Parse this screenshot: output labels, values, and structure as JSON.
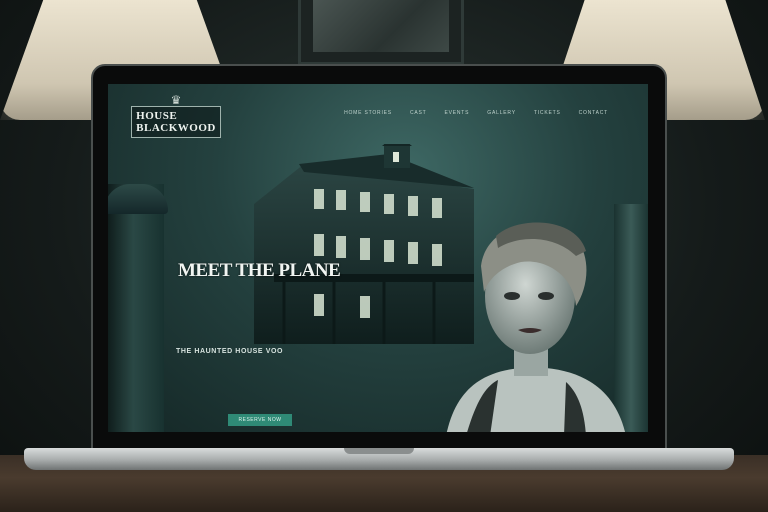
{
  "site": {
    "logo_text": "HOUSE BLACKWOOD",
    "nav": [
      "HOME STORIES",
      "CAST",
      "EVENTS",
      "GALLERY",
      "TICKETS",
      "CONTACT"
    ],
    "hero_title": "MEET THE PLANE",
    "hero_subtitle": "",
    "tagline_heading": "THE HAUNTED HOUSE VOO",
    "body_text": "",
    "cta_label": "RESERVE NOW"
  },
  "colors": {
    "accent": "#2f8a76",
    "screen_bg": "#24413f"
  }
}
